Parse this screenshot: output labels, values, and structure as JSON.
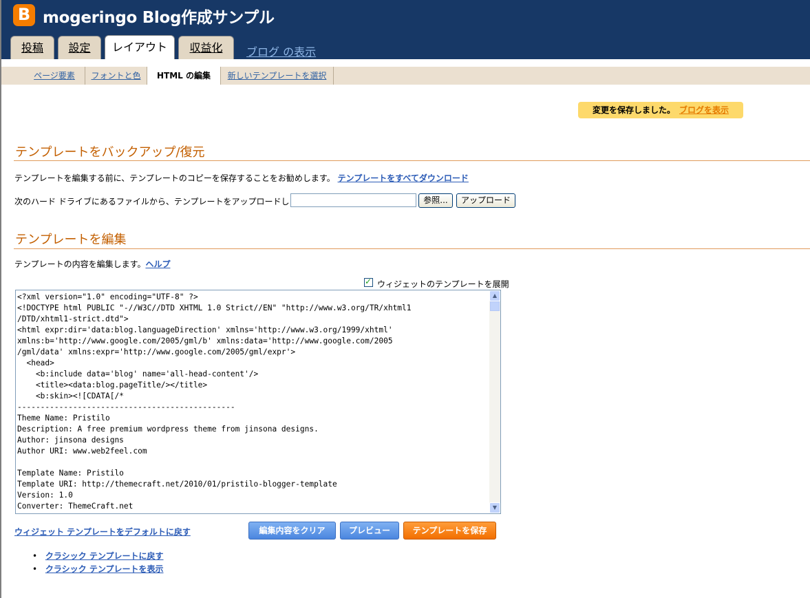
{
  "header": {
    "logo_letter": "B",
    "title": "mogeringo Blog作成サンプル"
  },
  "tabs": [
    {
      "label": "投稿"
    },
    {
      "label": "設定"
    },
    {
      "label": "レイアウト"
    },
    {
      "label": "収益化"
    }
  ],
  "tab_blog_view": "ブログ の表示",
  "subnav": [
    {
      "label": "ページ要素"
    },
    {
      "label": "フォントと色"
    },
    {
      "label": "HTML の編集"
    },
    {
      "label": "新しいテンプレートを選択"
    }
  ],
  "save_notice": {
    "text": "変更を保存しました。",
    "link": "ブログを表示"
  },
  "backup": {
    "title": "テンプレートをバックアップ/復元",
    "download_text": "テンプレートを編集する前に、テンプレートのコピーを保存することをお勧めします。",
    "download_link": "テンプレートをすべてダウンロード",
    "upload_text": "次のハード ドライブにあるファイルから、テンプレートをアップロードします。",
    "upload_value": "",
    "browse_label": "参照...",
    "upload_label": "アップロード"
  },
  "edit": {
    "title": "テンプレートを編集",
    "intro_text": "テンプレートの内容を編集します。",
    "help_link": "ヘルプ",
    "expand_label": "ウィジェットのテンプレートを展開",
    "expand_checked": true,
    "code": "<?xml version=\"1.0\" encoding=\"UTF-8\" ?>\n<!DOCTYPE html PUBLIC \"-//W3C//DTD XHTML 1.0 Strict//EN\" \"http://www.w3.org/TR/xhtml1\n/DTD/xhtml1-strict.dtd\">\n<html expr:dir='data:blog.languageDirection' xmlns='http://www.w3.org/1999/xhtml'\nxmlns:b='http://www.google.com/2005/gml/b' xmlns:data='http://www.google.com/2005\n/gml/data' xmlns:expr='http://www.google.com/2005/gml/expr'>\n  <head>\n    <b:include data='blog' name='all-head-content'/>\n    <title><data:blog.pageTitle/></title>\n    <b:skin><![CDATA[/*\n-----------------------------------------------\nTheme Name: Pristilo\nDescription: A free premium wordpress theme from jinsona designs.\nAuthor: jinsona designs\nAuthor URI: www.web2feel.com\n\nTemplate Name: Pristilo\nTemplate URI: http://themecraft.net/2010/01/pristilo-blogger-template\nVersion: 1.0\nConverter: ThemeCraft.net",
    "reset_widgets_link": "ウィジェット テンプレートをデフォルトに戻す",
    "clear_label": "編集内容をクリア",
    "preview_label": "プレビュー",
    "save_label": "テンプレートを保存"
  },
  "classic_links": [
    {
      "label": "クラシック テンプレートに戻す"
    },
    {
      "label": "クラシック テンプレートを表示"
    }
  ],
  "colors": {
    "header_bg": "#173866",
    "accent_orange": "#c35f00",
    "link_blue": "#2b5bb6"
  }
}
